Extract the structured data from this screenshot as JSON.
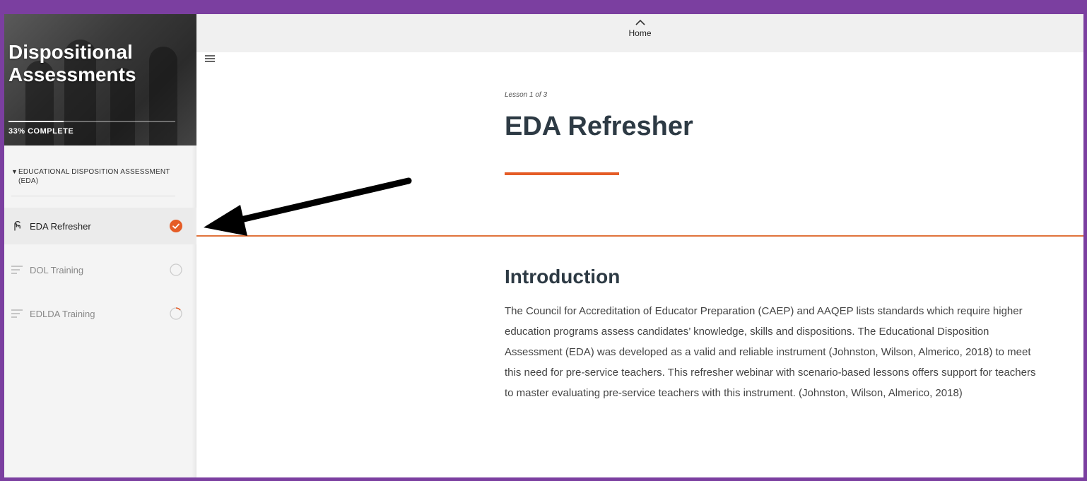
{
  "sidebar": {
    "course_title": "Dispositional Assessments",
    "progress_percent": 33,
    "progress_label": "33% COMPLETE",
    "section_header": "EDUCATIONAL DISPOSITION ASSESSMENT (EDA)",
    "lessons": [
      {
        "label": "EDA Refresher",
        "status": "complete",
        "icon": "hand-pointer-icon"
      },
      {
        "label": "DOL Training",
        "status": "not-started",
        "icon": "lines-icon"
      },
      {
        "label": "EDLDA Training",
        "status": "in-progress",
        "icon": "lines-icon"
      }
    ]
  },
  "topbar": {
    "home_label": "Home"
  },
  "main": {
    "lesson_count": "Lesson 1 of 3",
    "lesson_title": "EDA Refresher",
    "intro_heading": "Introduction",
    "intro_body": "The Council for Accreditation of Educator Preparation (CAEP) and AAQEP lists standards which require higher education programs assess candidates’ knowledge, skills and dispositions. The Educational Disposition Assessment (EDA) was developed as a valid and reliable instrument (Johnston, Wilson, Almerico, 2018) to meet this need for pre-service teachers. This refresher webinar with scenario-based lessons offers support for teachers to master evaluating pre-service teachers with this instrument. (Johnston, Wilson, Almerico, 2018)"
  },
  "colors": {
    "accent": "#e55c26",
    "frame": "#7b3fa0",
    "heading": "#2d3a44"
  }
}
